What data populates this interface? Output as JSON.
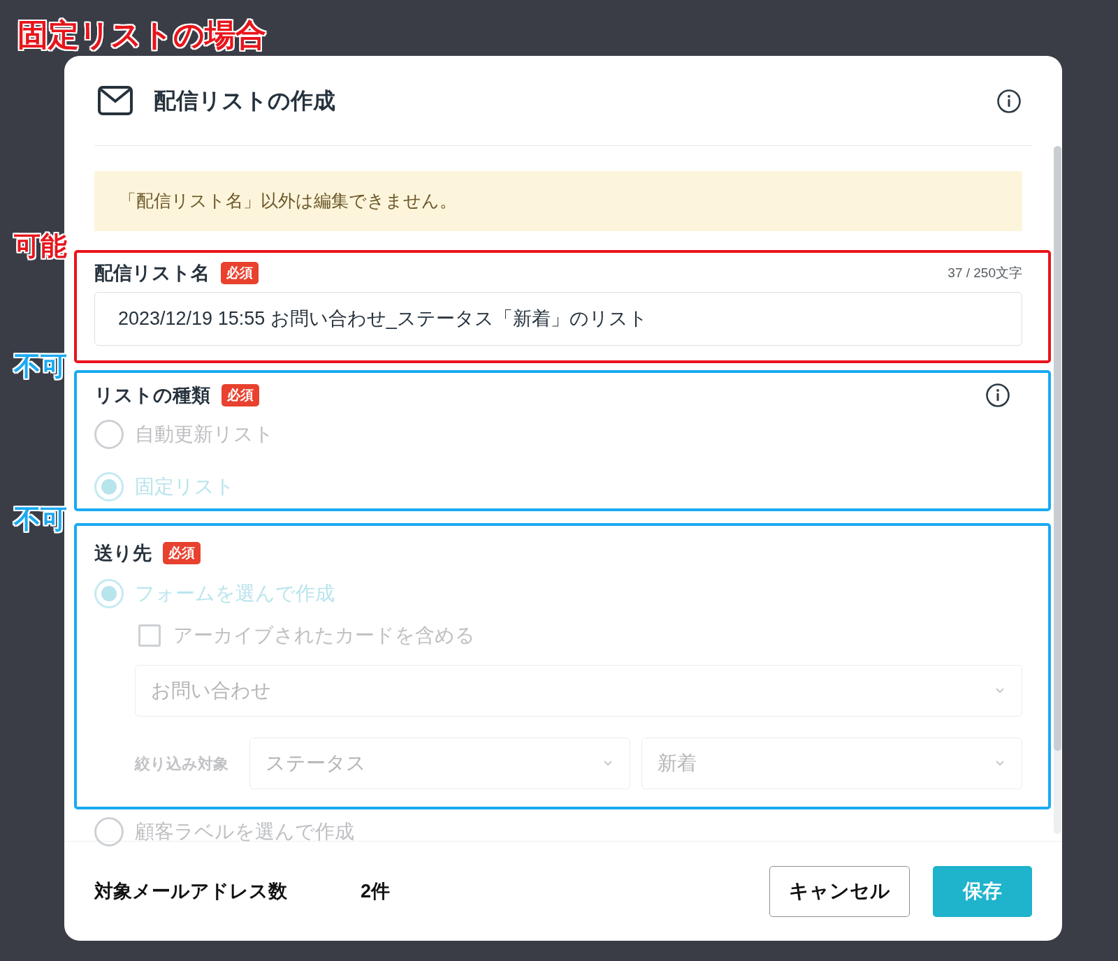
{
  "annotation": {
    "title": "固定リストの場合"
  },
  "dialog": {
    "title": "配信リストの作成",
    "notice": "「配信リスト名」以外は編集できません。",
    "fields": [
      {
        "kind": "text",
        "label": "配信リスト名",
        "badge": "必須",
        "counter": "37 / 250文字",
        "value": "2023/12/19 15:55 お問い合わせ_ステータス「新着」のリスト",
        "disabled": false,
        "has_info": false,
        "note": {
          "label": "可能",
          "color": "#e8141b"
        }
      },
      {
        "kind": "radio",
        "label": "リストの種類",
        "badge": "必須",
        "disabled": true,
        "has_info": true,
        "note": {
          "label": "不可",
          "color": "#1aaaf2"
        },
        "options": [
          {
            "label": "自動更新リスト",
            "selected": false
          },
          {
            "label": "固定リスト",
            "selected": true
          }
        ]
      },
      {
        "kind": "destination",
        "label": "送り先",
        "badge": "必須",
        "disabled": true,
        "has_info": false,
        "note": {
          "label": "不可",
          "color": "#1aaaf2"
        },
        "options": [
          {
            "label": "フォームを選んで作成",
            "selected": true,
            "checkbox": {
              "label": "アーカイブされたカードを含める",
              "checked": false
            },
            "form_select": {
              "value": "お問い合わせ"
            },
            "filter": {
              "label": "絞り込み対象",
              "field_select": {
                "value": "ステータス"
              },
              "value_select": {
                "value": "新着"
              }
            }
          }
        ]
      },
      {
        "kind": "option",
        "label": "顧客ラベルを選んで作成",
        "selected": false,
        "disabled": true
      }
    ],
    "footer": {
      "label": "対象メールアドレス数",
      "count": "2件",
      "buttons": [
        {
          "label": "キャンセル",
          "kind": "secondary"
        },
        {
          "label": "保存",
          "kind": "primary"
        }
      ]
    }
  }
}
